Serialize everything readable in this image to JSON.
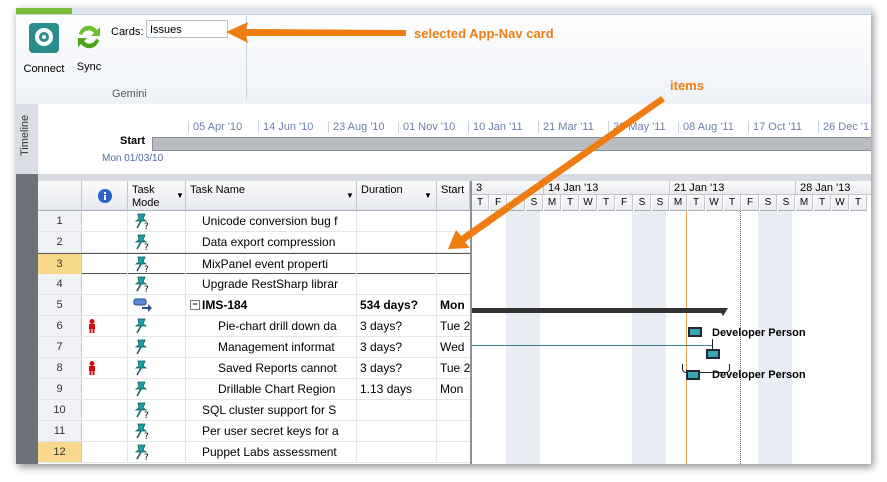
{
  "ribbon": {
    "connect_label": "Connect",
    "sync_label": "Sync",
    "cards_label": "Cards:",
    "cards_value": "Issues",
    "group_label": "Gemini"
  },
  "timeline": {
    "side_label": "Timeline",
    "start_label": "Start",
    "start_date": "Mon 01/03/10",
    "ticks": [
      "05 Apr '10",
      "14 Jun '10",
      "23 Aug '10",
      "01 Nov '10",
      "10 Jan '11",
      "21 Mar '11",
      "30 May '11",
      "08 Aug '11",
      "17 Oct '11",
      "26 Dec '1"
    ]
  },
  "table": {
    "headers": {
      "mode": "Task\nMode",
      "name": "Task Name",
      "duration": "Duration",
      "start": "Start"
    },
    "rows": [
      {
        "num": "1",
        "name": "Unicode conversion bug f",
        "duration": "",
        "start": ""
      },
      {
        "num": "2",
        "name": "Data export compression",
        "duration": "",
        "start": ""
      },
      {
        "num": "3",
        "name": "MixPanel event properti",
        "duration": "",
        "start": ""
      },
      {
        "num": "4",
        "name": "Upgrade RestSharp librar",
        "duration": "",
        "start": ""
      },
      {
        "num": "5",
        "name": "IMS-184",
        "duration": "534 days?",
        "start": "Mon"
      },
      {
        "num": "6",
        "name": "Pie-chart drill down da",
        "duration": "3 days?",
        "start": "Tue 2"
      },
      {
        "num": "7",
        "name": "Management informat",
        "duration": "3 days?",
        "start": "Wed"
      },
      {
        "num": "8",
        "name": "Saved Reports cannot",
        "duration": "3 days?",
        "start": "Tue 2"
      },
      {
        "num": "9",
        "name": "Drillable Chart Region",
        "duration": "1.13 days",
        "start": "Mon"
      },
      {
        "num": "10",
        "name": "SQL cluster support for S",
        "duration": "",
        "start": ""
      },
      {
        "num": "11",
        "name": "Per user secret keys for a",
        "duration": "",
        "start": ""
      },
      {
        "num": "12",
        "name": "Puppet Labs assessment",
        "duration": "",
        "start": ""
      }
    ]
  },
  "gantt": {
    "weeks": [
      "3",
      "14 Jan '13",
      "21 Jan '13",
      "28 Jan '13"
    ],
    "days": [
      "T",
      "F",
      "S",
      "S",
      "M",
      "T",
      "W",
      "T",
      "F",
      "S",
      "S",
      "M",
      "T",
      "W",
      "T",
      "F",
      "S",
      "S",
      "M",
      "T",
      "W",
      "T"
    ],
    "resource_label_1": "Developer Person",
    "resource_label_2": "Developer Person"
  },
  "callouts": {
    "card": "selected App-Nav card",
    "items": "items"
  },
  "colors": {
    "accent": "#f07d12",
    "bar": "#36a6b0",
    "highlight_row": "#f8d98b"
  }
}
